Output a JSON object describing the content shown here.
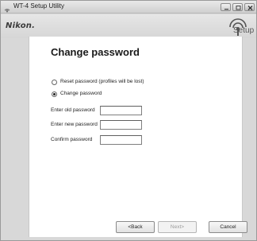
{
  "window": {
    "title": "WT-4 Setup Utility",
    "icons": {
      "app": "wireless-app-icon",
      "minimize": "minimize-icon",
      "maximize": "maximize-icon",
      "close": "close-icon"
    }
  },
  "header": {
    "brand": "Nikon.",
    "setup_logo_icon": "wireless-signal-icon",
    "setup_label": "Setup"
  },
  "main": {
    "heading": "Change password",
    "options": [
      {
        "label": "Reset password (profiles will be lost)",
        "selected": false
      },
      {
        "label": "Change password",
        "selected": true
      }
    ],
    "fields": [
      {
        "label": "Enter old password",
        "value": ""
      },
      {
        "label": "Enter new password",
        "value": ""
      },
      {
        "label": "Confirm password",
        "value": ""
      }
    ]
  },
  "footer": {
    "back_label": "<Back",
    "next_label": "Next>",
    "cancel_label": "Cancel",
    "next_enabled": false
  }
}
